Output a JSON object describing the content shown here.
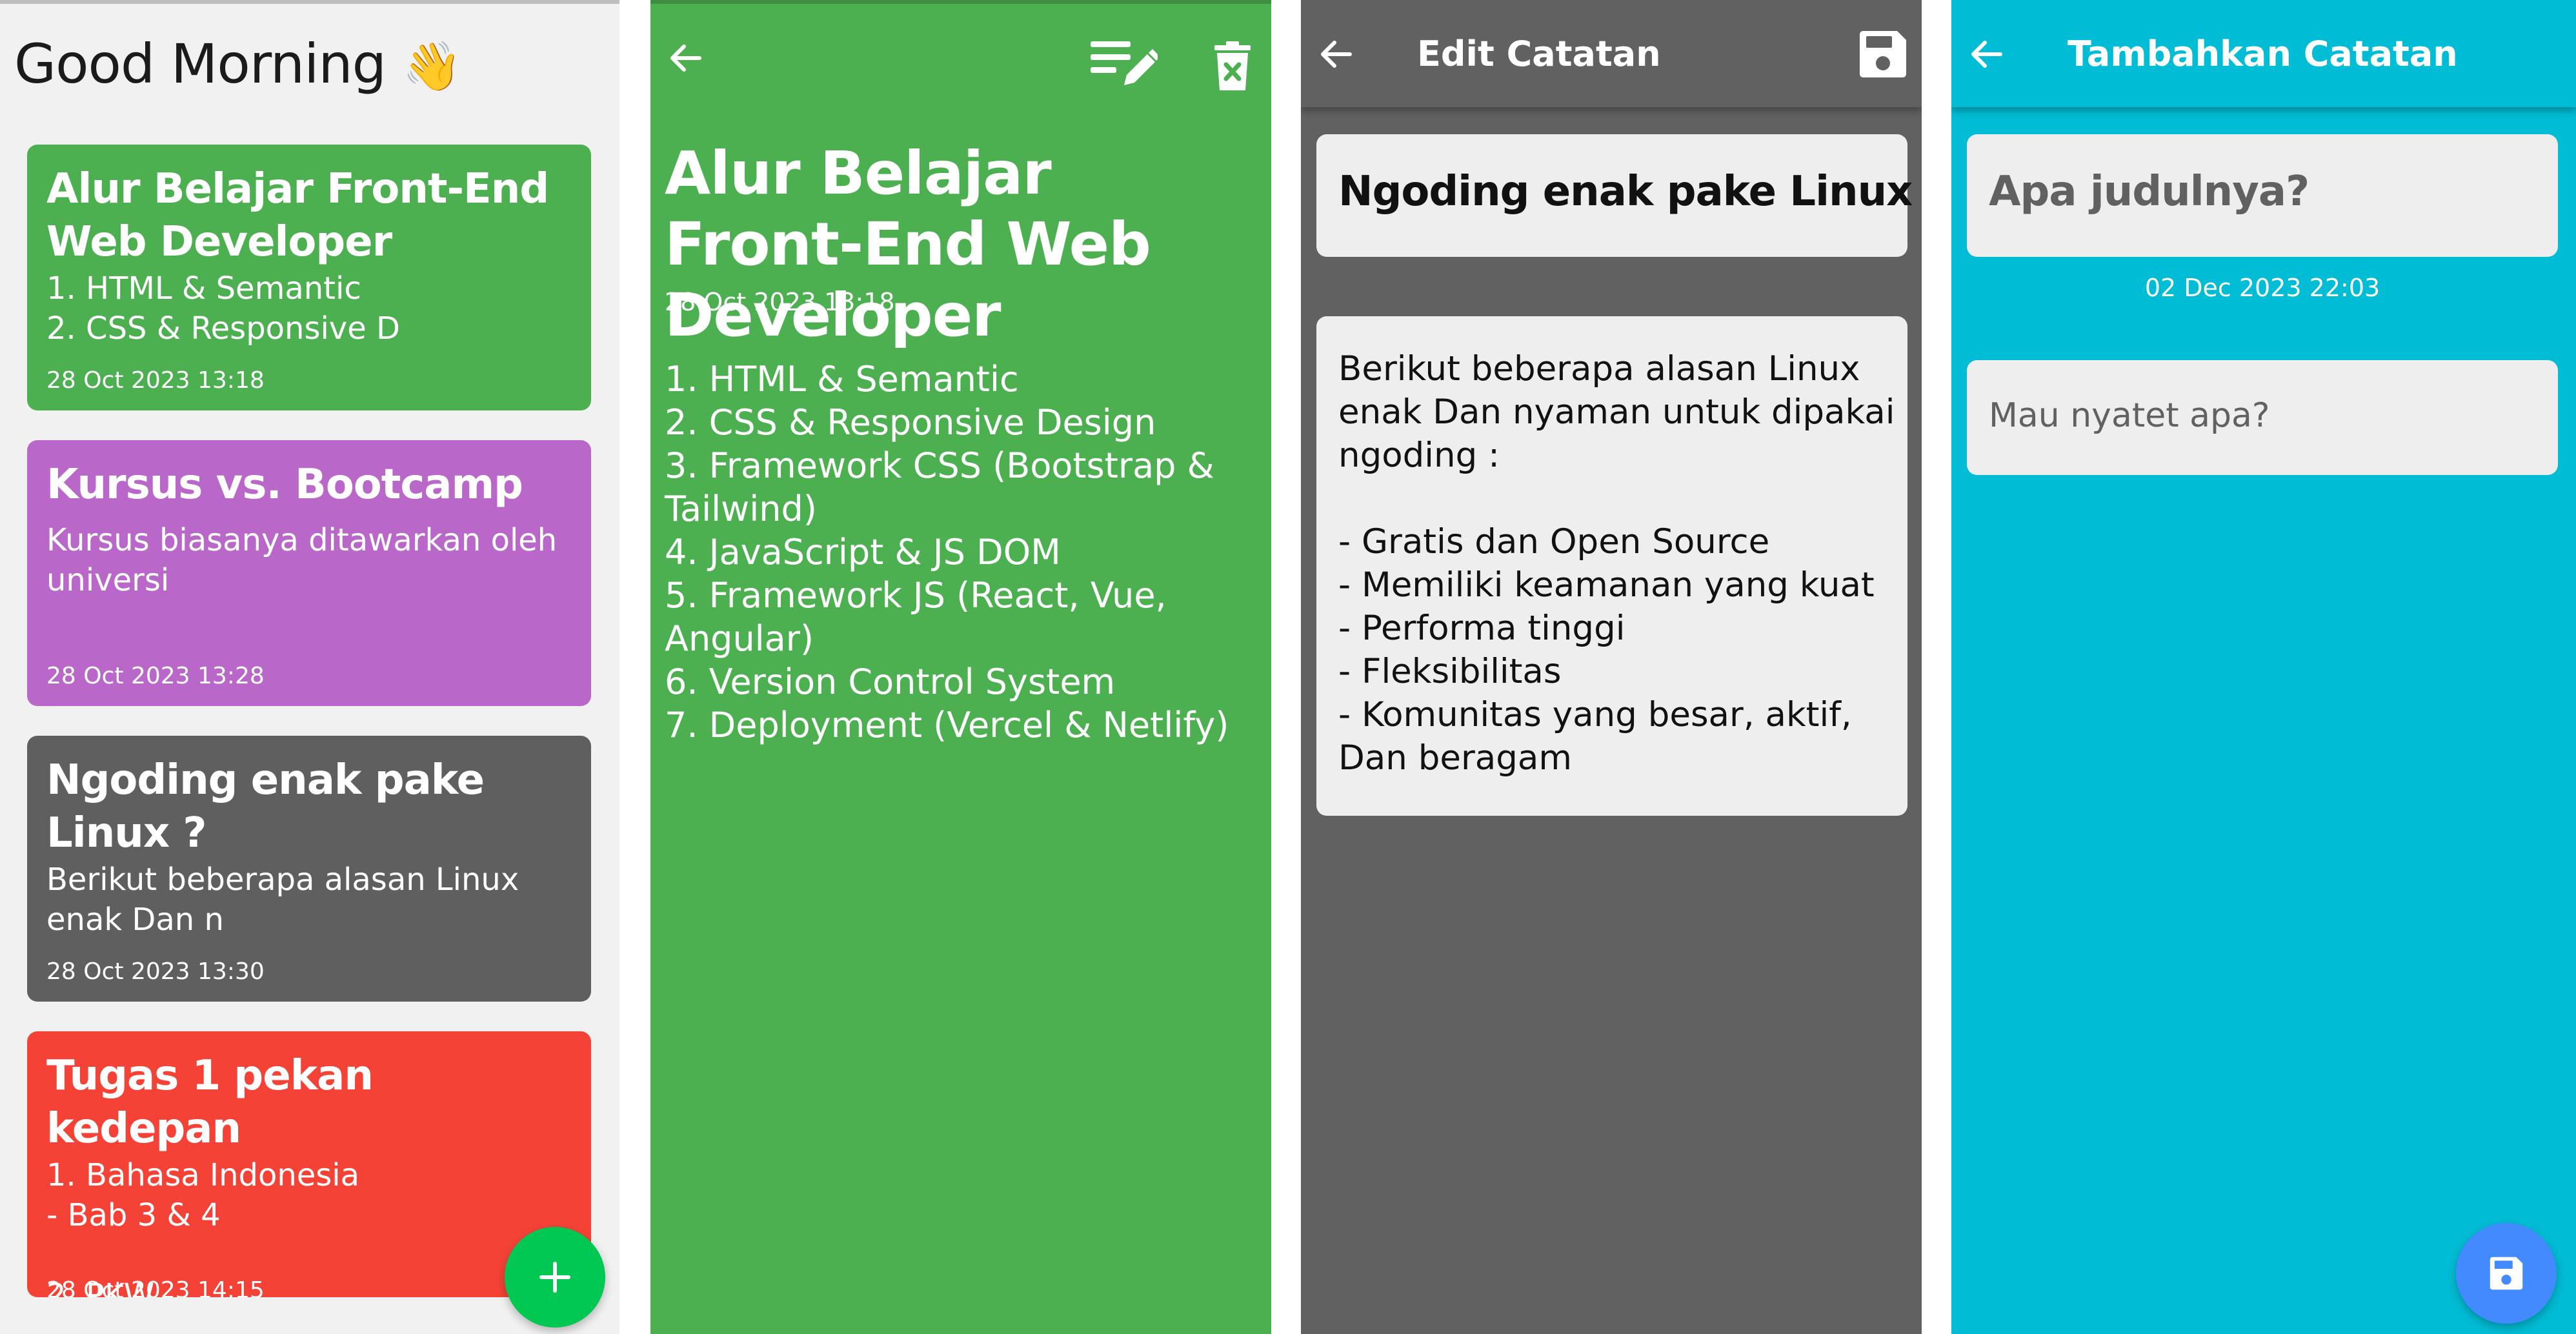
{
  "colors": {
    "home_bg": "#f1f1f1",
    "green": "#4caf50",
    "purple": "#b967c9",
    "grey": "#5f5f5f",
    "red": "#f44336",
    "cyan": "#00bcd4",
    "fab_add": "#00c853",
    "fab_save": "#448aff"
  },
  "home": {
    "greeting": "Good Morning",
    "greeting_emoji": "👋",
    "notes": [
      {
        "title": "Alur Belajar Front-End Web Developer",
        "preview": "1. HTML & Semantic\n2. CSS & Responsive D",
        "date": "28 Oct 2023 13:18",
        "color": "#4caf50"
      },
      {
        "title": "Kursus vs. Bootcamp",
        "preview": "Kursus biasanya ditawarkan oleh universi",
        "date": "28 Oct 2023 13:28",
        "color": "#b967c9"
      },
      {
        "title": "Ngoding enak pake Linux ?",
        "preview": "Berikut beberapa alasan Linux enak Dan n",
        "date": "28 Oct 2023 13:30",
        "color": "#5f5f5f"
      },
      {
        "title": "Tugas 1 pekan kedepan",
        "preview": "1. Bahasa Indonesia\n- Bab 3 & 4\n\n2. PKW",
        "date": "28 Oct 2023 14:15",
        "color": "#f44336"
      }
    ],
    "fab_icon": "plus-icon"
  },
  "detail": {
    "back_icon": "back-arrow-icon",
    "edit_icon": "edit-note-icon",
    "delete_icon": "delete-icon",
    "title": "Alur Belajar Front-End Web Developer",
    "date": "28 Oct 2023 13:18",
    "body": "1. HTML & Semantic\n2. CSS & Responsive Design\n3. Framework CSS (Bootstrap & Tailwind)\n4. JavaScript & JS DOM\n5. Framework JS (React, Vue, Angular)\n6. Version Control System\n7. Deployment (Vercel & Netlify)"
  },
  "edit": {
    "appbar_title": "Edit Catatan",
    "back_icon": "back-arrow-icon",
    "save_icon": "save-icon",
    "title_value": "Ngoding enak pake Linux ?",
    "body_value": "Berikut beberapa alasan Linux enak Dan nyaman untuk dipakai ngoding :\n\n- Gratis dan Open Source\n- Memiliki keamanan yang kuat\n- Performa tinggi\n- Fleksibilitas\n- Komunitas yang besar, aktif, Dan beragam"
  },
  "add": {
    "appbar_title": "Tambahkan Catatan",
    "back_icon": "back-arrow-icon",
    "title_placeholder": "Apa judulnya?",
    "date": "02 Dec 2023 22:03",
    "body_placeholder": "Mau nyatet apa?",
    "fab_icon": "save-icon"
  }
}
